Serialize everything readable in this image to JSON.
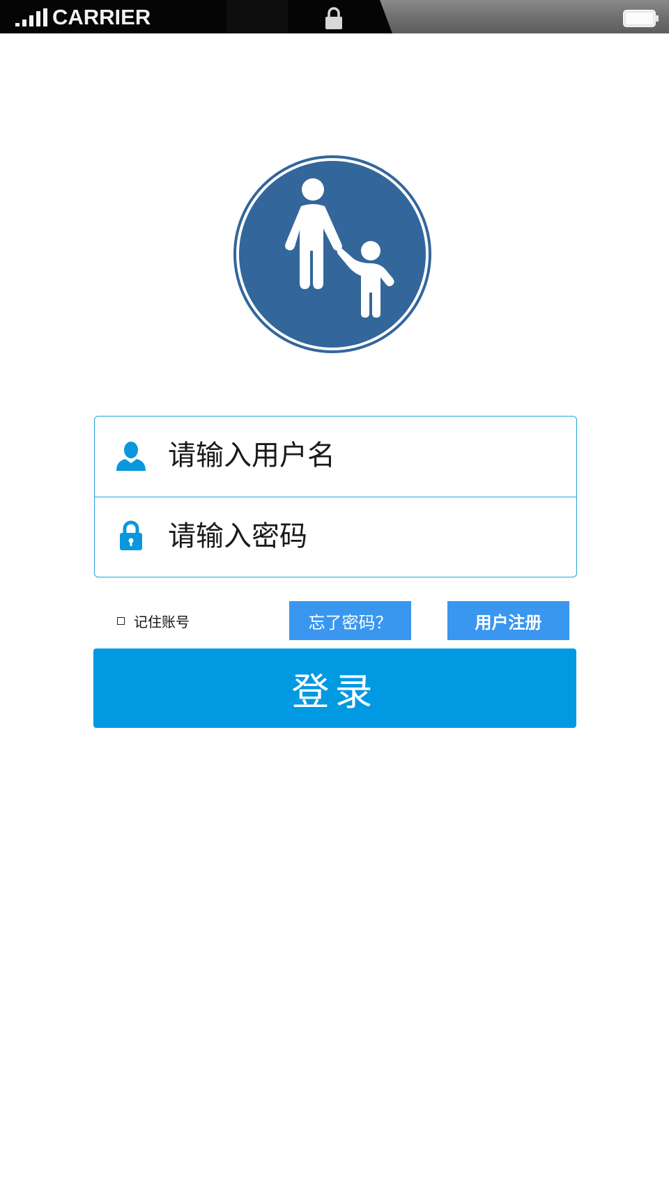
{
  "status_bar": {
    "carrier": "CARRIER",
    "signal_icon": "signal-bars-icon",
    "lock_icon": "lock-icon",
    "battery_icon": "battery-icon"
  },
  "logo": {
    "icon": "parent-child-walking-icon",
    "color": "#33669b"
  },
  "login_form": {
    "username": {
      "icon": "user-icon",
      "placeholder": "请输入用户名",
      "value": ""
    },
    "password": {
      "icon": "lock-icon",
      "placeholder": "请输入密码",
      "value": ""
    }
  },
  "options": {
    "remember_label": "记住账号",
    "remember_checked": false,
    "forgot_label": "忘了密码？",
    "register_label": "用户注册"
  },
  "login_button": {
    "label": "登录"
  },
  "colors": {
    "accent": "#0199e2",
    "button_secondary": "#3997f0",
    "border": "#1fa3e0",
    "logo": "#33669b"
  }
}
